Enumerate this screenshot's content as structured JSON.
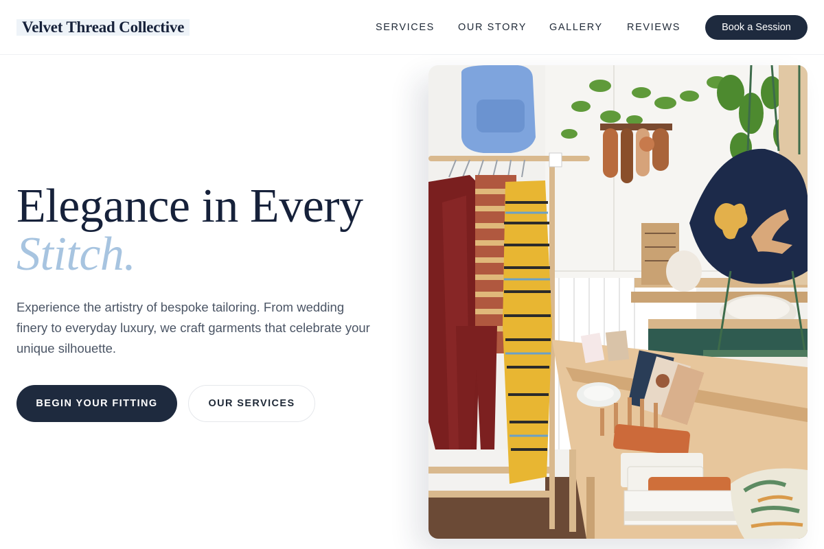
{
  "brand": {
    "name": "Velvet Thread Collective"
  },
  "nav": {
    "items": [
      {
        "label": "SERVICES"
      },
      {
        "label": "OUR STORY"
      },
      {
        "label": "GALLERY"
      },
      {
        "label": "REVIEWS"
      }
    ],
    "cta_label": "Book a Session"
  },
  "hero": {
    "headline_line1": "Elegance in Every",
    "headline_accent": "Stitch.",
    "description": "Experience the artistry of bespoke tailoring. From wedding finery to everyday luxury, we craft garments that celebrate your unique silhouette.",
    "primary_button": "BEGIN YOUR FITTING",
    "secondary_button": "OUR SERVICES"
  },
  "colors": {
    "navy": "#1e2a3e",
    "accent_blue": "#a7c4e0",
    "body_text": "#4b5565"
  }
}
